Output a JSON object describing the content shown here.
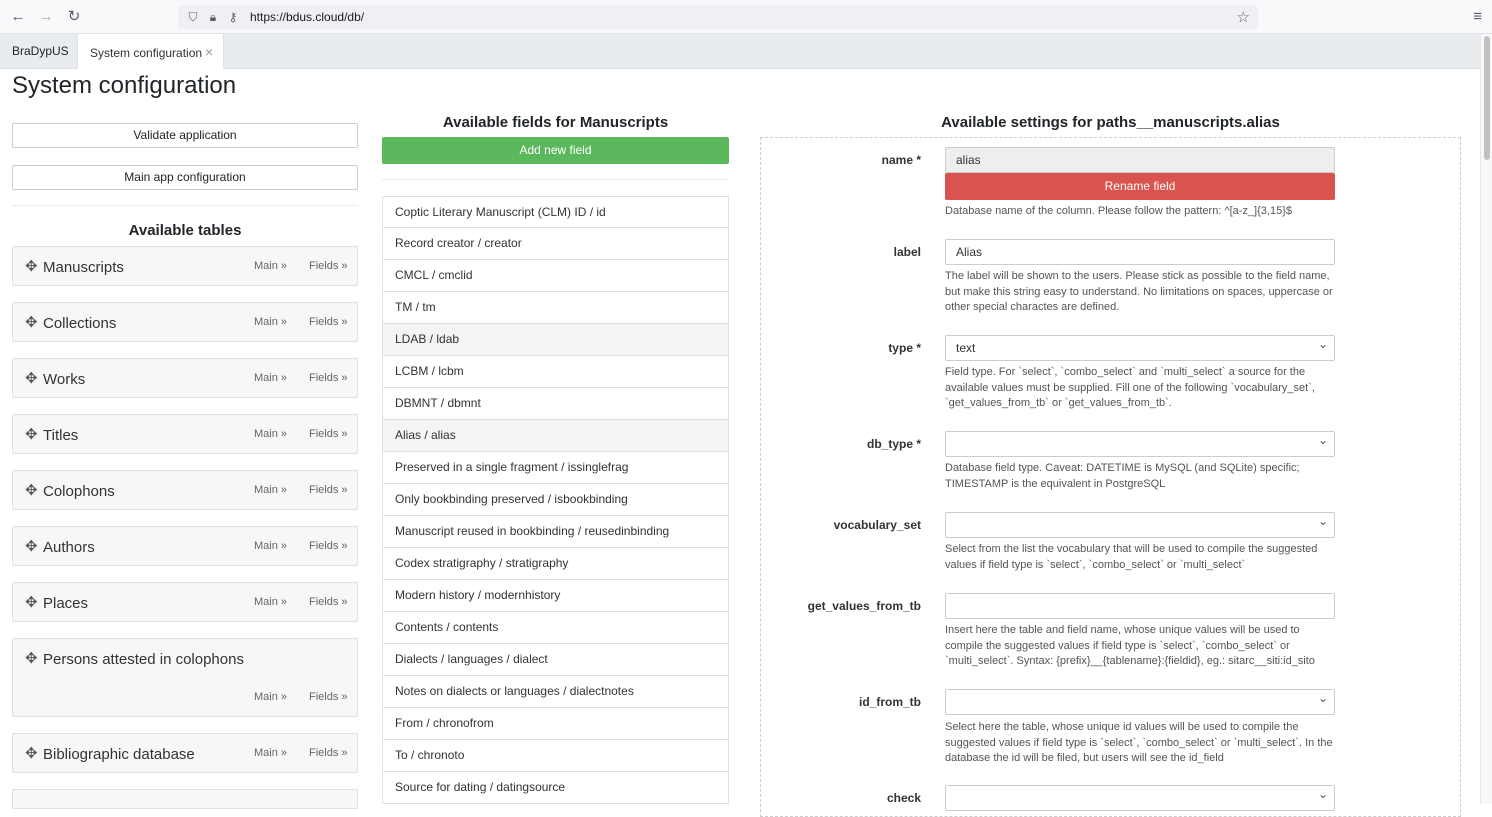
{
  "browser": {
    "url_prefix": "https://",
    "url_host": "bdus.cloud",
    "url_path": "/db/"
  },
  "app": {
    "brand": "BraDypUS",
    "active_tab": "System configuration",
    "tab_close": "×"
  },
  "page": {
    "title": "System configuration"
  },
  "left": {
    "validate_label": "Validate application",
    "main_config_label": "Main app configuration",
    "available_tables_heading": "Available tables",
    "main_link": "Main »",
    "fields_link": "Fields »",
    "tables": [
      {
        "name": "Manuscripts"
      },
      {
        "name": "Collections"
      },
      {
        "name": "Works"
      },
      {
        "name": "Titles"
      },
      {
        "name": "Colophons"
      },
      {
        "name": "Authors"
      },
      {
        "name": "Places"
      },
      {
        "name": "Persons attested in colophons"
      },
      {
        "name": "Bibliographic database"
      }
    ]
  },
  "middle": {
    "heading": "Available fields for Manuscripts",
    "add_new_label": "Add new field",
    "fields": [
      "Coptic Literary Manuscript (CLM) ID / id",
      "Record creator / creator",
      "CMCL / cmclid",
      "TM / tm",
      "LDAB / ldab",
      "LCBM / lcbm",
      "DBMNT / dbmnt",
      "Alias / alias",
      "Preserved in a single fragment / issinglefrag",
      "Only bookbinding preserved / isbookbinding",
      "Manuscript reused in bookbinding / reusedinbinding",
      "Codex stratigraphy / stratigraphy",
      "Modern history / modernhistory",
      "Contents / contents",
      "Dialects / languages / dialect",
      "Notes on dialects or languages / dialectnotes",
      "From / chronofrom",
      "To / chronoto",
      "Source for dating / datingsource"
    ]
  },
  "right": {
    "heading": "Available settings for paths__manuscripts.alias",
    "name": {
      "label": "name *",
      "value": "alias",
      "rename_label": "Rename field",
      "help": "Database name of the column. Please follow the pattern: ^[a-z_]{3,15}$"
    },
    "label": {
      "label": "label",
      "value": "Alias",
      "help": "The label will be shown to the users. Please stick as possible to the field name, but make this string easy to understand. No limitations on spaces, uppercase or other special charactes are defined."
    },
    "type": {
      "label": "type *",
      "value": "text",
      "help": "Field type. For `select`, `combo_select` and `multi_select` a source for the available values must be supplied. Fill one of the following `vocabulary_set`, `get_values_from_tb` or `get_values_from_tb`."
    },
    "db_type": {
      "label": "db_type *",
      "value": "",
      "help": "Database field type. Caveat: DATETIME is MySQL (and SQLite) specific; TIMESTAMP is the equivalent in PostgreSQL"
    },
    "vocabulary_set": {
      "label": "vocabulary_set",
      "value": "",
      "help": "Select from the list the vocabulary that will be used to compile the suggested values if field type is `select`, `combo_select` or `multi_select`"
    },
    "get_values_from_tb": {
      "label": "get_values_from_tb",
      "value": "",
      "help": "Insert here the table and field name, whose unique values will be used to compile the suggested values if field type is `select`, `combo_select` or `multi_select`. Syntax: {prefix}__{tablename}:{fieldid}, eg.: sitarc__siti:id_sito"
    },
    "id_from_tb": {
      "label": "id_from_tb",
      "value": "",
      "help": "Select here the table, whose unique id values will be used to compile the suggested values if field type is `select`, `combo_select` or `multi_select`. In the database the id will be filed, but users will see the id_field"
    },
    "check": {
      "label": "check",
      "value": ""
    }
  }
}
